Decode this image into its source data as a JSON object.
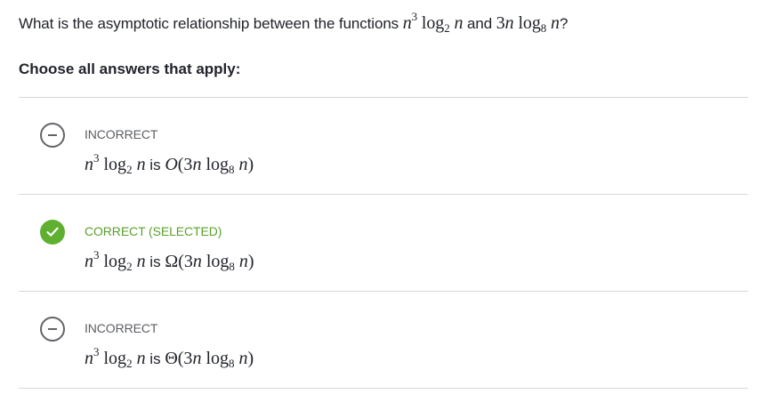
{
  "question": {
    "prefix": "What is the asymptotic relationship between the functions",
    "conjunction": "and",
    "suffix": "?"
  },
  "instruction": "Choose all answers that apply:",
  "choices": [
    {
      "status": "INCORRECT",
      "state": "incorrect",
      "connector": "is",
      "notation": "O"
    },
    {
      "status": "CORRECT (SELECTED)",
      "state": "correct",
      "connector": "is",
      "notation": "Ω"
    },
    {
      "status": "INCORRECT",
      "state": "incorrect",
      "connector": "is",
      "notation": "Θ"
    }
  ],
  "colors": {
    "correct": "#5fb030",
    "incorrect_icon": "#626569",
    "divider": "#d6d8da"
  },
  "icons": [
    "minus-circle-icon",
    "checkmark-circle-icon"
  ]
}
